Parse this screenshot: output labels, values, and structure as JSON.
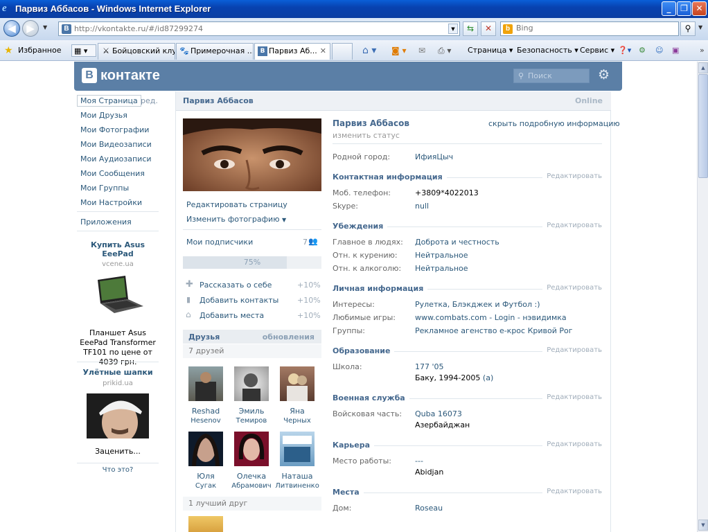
{
  "window": {
    "title": "Парвиз Аббасов - Windows Internet Explorer"
  },
  "browser": {
    "url": "http://vkontakte.ru/#/id87299274",
    "search_placeholder": "Bing",
    "favorites_label": "Избранное",
    "tabs": [
      {
        "label": "Бойцовский клуб",
        "icon": "swords-icon"
      },
      {
        "label": "Примерочная ...",
        "icon": "cat-icon"
      },
      {
        "label": "Парвиз Аб...",
        "icon": "vk-icon",
        "active": true
      }
    ],
    "toolbar": {
      "page": "Страница",
      "security": "Безопасность",
      "service": "Сервис"
    }
  },
  "vk": {
    "logo": "контакте",
    "logo_letter": "В",
    "search_placeholder": "Поиск"
  },
  "left_menu": {
    "items": [
      "Моя Страница",
      "Мои Друзья",
      "Мои Фотографии",
      "Мои Видеозаписи",
      "Мои Аудиозаписи",
      "Мои Сообщения",
      "Мои Группы",
      "Мои Настройки"
    ],
    "edit": "ред.",
    "apps": "Приложения"
  },
  "ads": [
    {
      "title": "Купить Asus EeePad",
      "source": "vcene.ua",
      "text": "Планшет Asus EeePad Transformer TF101 по цене от 4039 грн."
    },
    {
      "title": "Улётные шапки",
      "source": "prikid.ua",
      "text": "Заценить..."
    }
  ],
  "ad_info": "Что это?",
  "profile": {
    "header_name": "Парвиз Аббасов",
    "online": "Online",
    "name": "Парвиз Аббасов",
    "change_status": "изменить статус",
    "hide_info": "скрыть подробную информацию",
    "edit_page": "Редактировать страницу",
    "change_photo": "Изменить фотографию",
    "subscribers_label": "Мои подписчики",
    "subscribers_count": "7",
    "progress_percent": 75,
    "progress_label": "75%",
    "actions": [
      {
        "label": "Рассказать о себе",
        "bonus": "+10%",
        "icon": "plus-icon"
      },
      {
        "label": "Добавить контакты",
        "bonus": "+10%",
        "icon": "phone-icon"
      },
      {
        "label": "Добавить места",
        "bonus": "+10%",
        "icon": "home-icon"
      }
    ],
    "friends_title": "Друзья",
    "friends_updates": "обновления",
    "friends_count": "7 друзей",
    "friends": [
      {
        "first": "Reshad",
        "last": "Hesenov"
      },
      {
        "first": "Эмиль",
        "last": "Темиров"
      },
      {
        "first": "Яна",
        "last": "Черных"
      },
      {
        "first": "Юля",
        "last": "Сугак"
      },
      {
        "first": "Олечка",
        "last": "Абрамович"
      },
      {
        "first": "Наташа",
        "last": "Литвиненко"
      }
    ],
    "best_friend": "1 лучший друг",
    "edit_label": "Редактировать",
    "hometown": {
      "label": "Родной город:",
      "value": "ИфияЦыч"
    },
    "sections": {
      "contacts": {
        "title": "Контактная информация",
        "rows": [
          {
            "label": "Моб. телефон:",
            "value": "+3809*4022013"
          },
          {
            "label": "Skype:",
            "value": "null"
          }
        ]
      },
      "beliefs": {
        "title": "Убеждения",
        "rows": [
          {
            "label": "Главное в людях:",
            "value": "Доброта и честность"
          },
          {
            "label": "Отн. к курению:",
            "value": "Нейтральное"
          },
          {
            "label": "Отн. к алкоголю:",
            "value": "Нейтральное"
          }
        ]
      },
      "personal": {
        "title": "Личная информация",
        "rows": [
          {
            "label": "Интересы:",
            "value": "Рулетка, Блэкджек и Футбол :)"
          },
          {
            "label": "Любимые игры:",
            "value": "www.combats.com - Login - нэвидимка"
          },
          {
            "label": "Группы:",
            "value": "Рекламное агенство е-крос Кривой Рог"
          }
        ]
      },
      "education": {
        "title": "Образование",
        "school_label": "Школа:",
        "school": "177 '05",
        "school_city": "Баку, 1994-2005",
        "school_suffix": "(а)"
      },
      "military": {
        "title": "Военная служба",
        "label": "Войсковая часть:",
        "unit": "Quba 16073",
        "country": "Азербайджан"
      },
      "career": {
        "title": "Карьера",
        "label": "Место работы:",
        "value": "---",
        "city": "Abidjan"
      },
      "places": {
        "title": "Места",
        "label": "Дом:",
        "value": "Roseau"
      }
    }
  }
}
